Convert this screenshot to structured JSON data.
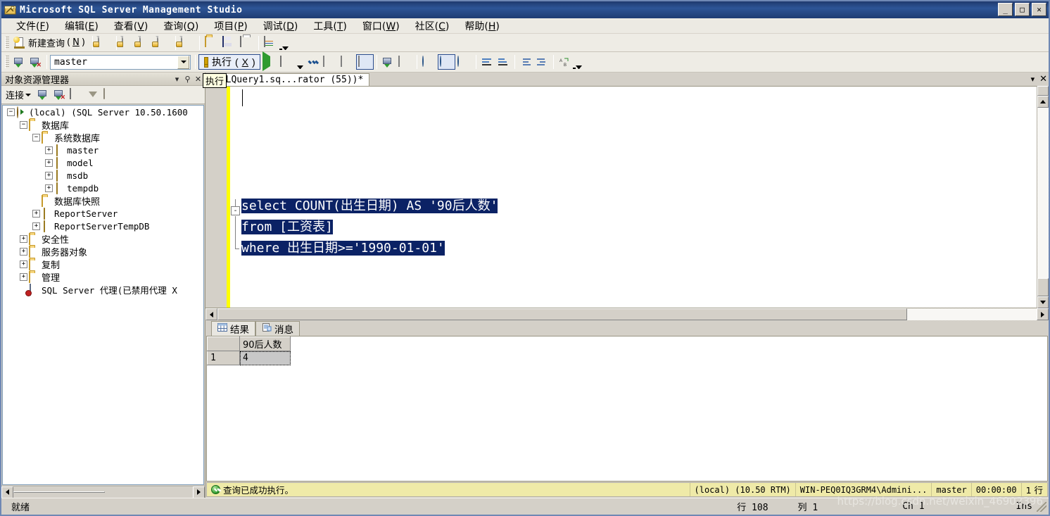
{
  "window": {
    "title": "Microsoft SQL Server Management Studio",
    "app_icon": "ssms-icon",
    "controls": {
      "minimize": "_",
      "maximize": "□",
      "close": "✕"
    }
  },
  "menubar": [
    {
      "label": "文件",
      "accel": "F"
    },
    {
      "label": "编辑",
      "accel": "E"
    },
    {
      "label": "查看",
      "accel": "V"
    },
    {
      "label": "查询",
      "accel": "Q"
    },
    {
      "label": "项目",
      "accel": "P"
    },
    {
      "label": "调试",
      "accel": "D"
    },
    {
      "label": "工具",
      "accel": "T"
    },
    {
      "label": "窗口",
      "accel": "W"
    },
    {
      "label": "社区",
      "accel": "C"
    },
    {
      "label": "帮助",
      "accel": "H"
    }
  ],
  "standard_toolbar": {
    "new_query_label": "新建查询",
    "new_query_accel": "N",
    "buttons": [
      "new-query-icon",
      "new-file-icon",
      "new-mdx-query-icon",
      "new-dmx-query-icon",
      "new-xmla-query-icon",
      "new-project-icon",
      "open-file-icon",
      "save-icon",
      "print-icon",
      "activity-monitor-icon"
    ],
    "overflow": "toolbar-overflow"
  },
  "query_toolbar": {
    "database_value": "master",
    "execute_label": "执行",
    "execute_accel": "X",
    "buttons": [
      "connect-icon",
      "disconnect-icon",
      "execute-icon",
      "debug-icon",
      "stop-icon",
      "parse-icon",
      "display-estimated-plan-icon",
      "query-options-icon",
      "include-actual-plan-icon",
      "include-client-statistics-icon",
      "results-to-text-icon",
      "results-to-grid-icon",
      "results-to-file-icon",
      "comment-icon",
      "uncomment-icon",
      "decrease-indent-icon",
      "increase-indent-icon",
      "find-replace-icon"
    ],
    "overflow": "toolbar-overflow"
  },
  "object_explorer": {
    "title": "对象资源管理器",
    "panel_buttons": [
      "window-position-icon",
      "auto-hide-pin-icon",
      "close-icon"
    ],
    "toolbar": {
      "connect_label": "连接",
      "buttons": [
        "connect-server-icon",
        "disconnect-server-icon",
        "stop-icon",
        "filter-icon",
        "refresh-icon"
      ]
    },
    "tree": [
      {
        "depth": 0,
        "toggle": "minus",
        "icon": "server-icon",
        "label": "(local) (SQL Server 10.50.1600",
        "cjk": false
      },
      {
        "depth": 1,
        "toggle": "minus",
        "icon": "folder-icon",
        "label": "数据库",
        "cjk": true
      },
      {
        "depth": 2,
        "toggle": "minus",
        "icon": "folder-icon",
        "label": "系统数据库",
        "cjk": true
      },
      {
        "depth": 3,
        "toggle": "plus",
        "icon": "database-icon",
        "label": "master",
        "cjk": false
      },
      {
        "depth": 3,
        "toggle": "plus",
        "icon": "database-icon",
        "label": "model",
        "cjk": false
      },
      {
        "depth": 3,
        "toggle": "plus",
        "icon": "database-icon",
        "label": "msdb",
        "cjk": false
      },
      {
        "depth": 3,
        "toggle": "plus",
        "icon": "database-icon",
        "label": "tempdb",
        "cjk": false
      },
      {
        "depth": 2,
        "toggle": "none",
        "icon": "folder-icon",
        "label": "数据库快照",
        "cjk": true
      },
      {
        "depth": 2,
        "toggle": "plus",
        "icon": "database-icon",
        "label": "ReportServer",
        "cjk": false
      },
      {
        "depth": 2,
        "toggle": "plus",
        "icon": "database-icon",
        "label": "ReportServerTempDB",
        "cjk": false
      },
      {
        "depth": 1,
        "toggle": "plus",
        "icon": "folder-icon",
        "label": "安全性",
        "cjk": true
      },
      {
        "depth": 1,
        "toggle": "plus",
        "icon": "folder-icon",
        "label": "服务器对象",
        "cjk": true
      },
      {
        "depth": 1,
        "toggle": "plus",
        "icon": "folder-icon",
        "label": "复制",
        "cjk": true
      },
      {
        "depth": 1,
        "toggle": "plus",
        "icon": "folder-icon",
        "label": "管理",
        "cjk": true
      },
      {
        "depth": 1,
        "toggle": "none",
        "icon": "sql-agent-disabled-icon",
        "label": "SQL Server 代理(已禁用代理 X",
        "cjk": false
      }
    ]
  },
  "document": {
    "tab_label": "SQLQuery1.sq...rator (55))*",
    "tab_buttons": [
      "tab-list-dropdown-icon",
      "close-icon"
    ],
    "tooltip": "执行",
    "code_lines": [
      {
        "text": "select COUNT(出生日期) AS '90后人数'",
        "selected": true
      },
      {
        "text": "from [工资表]",
        "selected": true
      },
      {
        "text": "where 出生日期>='1990-01-01'",
        "selected": true
      }
    ],
    "fold_marker": "-"
  },
  "results": {
    "tabs": [
      {
        "label": "结果",
        "icon": "grid-icon",
        "active": true
      },
      {
        "label": "消息",
        "icon": "messages-icon",
        "active": false
      }
    ],
    "grid": {
      "row_header": "",
      "columns": [
        "90后人数"
      ],
      "rows": [
        {
          "num": "1",
          "cells": [
            "4"
          ]
        }
      ],
      "selected_cell": "4"
    }
  },
  "query_status": {
    "message": "查询已成功执行。",
    "status_icon": "success-check-icon",
    "server": "(local) (10.50 RTM)",
    "user": "WIN-PEQ0IQ3GRM4\\Admini...",
    "database": "master",
    "elapsed": "00:00:00",
    "rows": "1 行"
  },
  "app_status": {
    "ready": "就绪",
    "line_label": "行",
    "line_value": "108",
    "col_label": "列",
    "col_value": "1",
    "ch_label": "Ch",
    "ch_value": "1",
    "insert_mode": "Ins"
  },
  "watermark": "https://blog.csdn.net/weixin_46902396",
  "colors": {
    "titlebar": "#1e3c72",
    "selection": "#0b2265",
    "toolbar_bg": "#eeece5",
    "panel_bg": "#d4d0c8",
    "status_bg": "#efeaa8",
    "accent_border": "#2b4d8e",
    "indicator_yellow": "#ffff00"
  }
}
